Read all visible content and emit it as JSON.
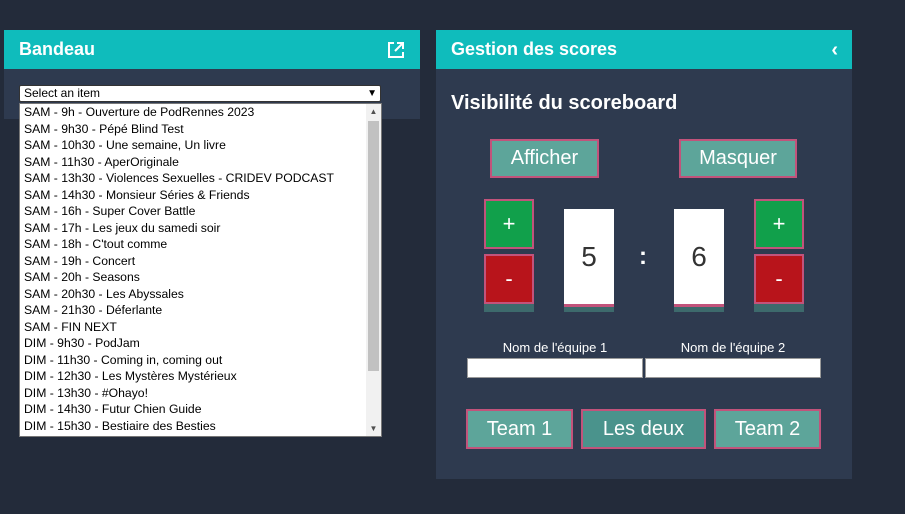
{
  "bandeau": {
    "title": "Bandeau",
    "icon": "external-link-icon",
    "select": {
      "selected": "Select an item",
      "options": [
        "SAM - 9h - Ouverture de PodRennes 2023",
        "SAM - 9h30 - Pépé Blind Test",
        "SAM - 10h30 - Une semaine, Un livre",
        "SAM - 11h30 - AperOriginale",
        "SAM - 13h30 - Violences Sexuelles - CRIDEV PODCAST",
        "SAM - 14h30 - Monsieur Séries & Friends",
        "SAM - 16h - Super Cover Battle",
        "SAM - 17h - Les jeux du samedi soir",
        "SAM - 18h - C'tout comme",
        "SAM - 19h - Concert",
        "SAM - 20h - Seasons",
        "SAM - 20h30 - Les Abyssales",
        "SAM - 21h30 - Déferlante",
        "SAM - FIN NEXT",
        "DIM - 9h30 - PodJam",
        "DIM - 11h30 - Coming in, coming out",
        "DIM - 12h30 - Les Mystères Mystérieux",
        "DIM - 13h30 - #Ohayo!",
        "DIM - 14h30 - Futur Chien Guide",
        "DIM - 15h30 - Bestiaire des Besties"
      ]
    }
  },
  "scores": {
    "title": "Gestion des scores",
    "collapse_icon": "chevron-left-icon",
    "visibility_title": "Visibilité du scoreboard",
    "show_label": "Afficher",
    "hide_label": "Masquer",
    "team1": {
      "plus": "+",
      "minus": "-",
      "score": "5",
      "name_label": "Nom de l'équipe 1",
      "name_value": ""
    },
    "team2": {
      "plus": "+",
      "minus": "-",
      "score": "6",
      "name_label": "Nom de l'équipe 2",
      "name_value": ""
    },
    "separator": ":",
    "buttons": {
      "team1": "Team 1",
      "both": "Les deux",
      "team2": "Team 2"
    }
  },
  "colors": {
    "background": "#232b3a",
    "panel": "#2e3a4f",
    "header": "#0fbcbc",
    "teal_button": "#5da59a",
    "border_accent": "#c2537b",
    "plus": "#11a04b",
    "minus": "#b8141b"
  }
}
